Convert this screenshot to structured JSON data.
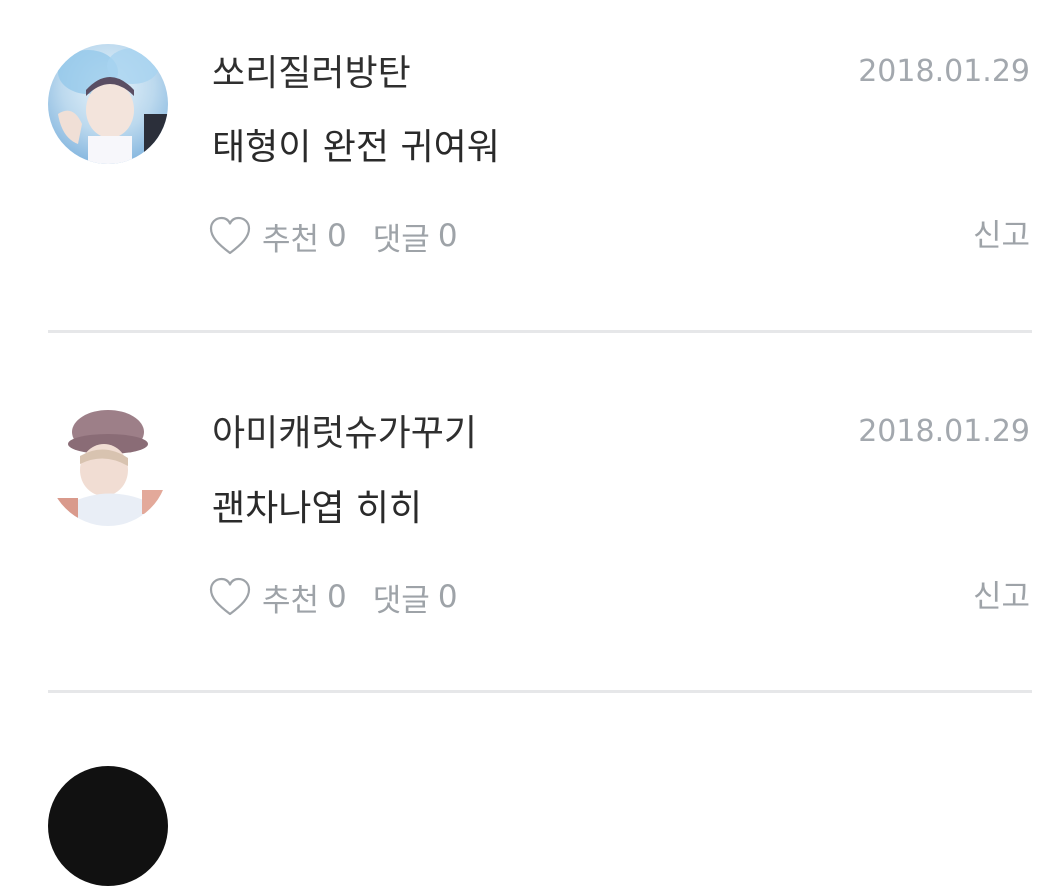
{
  "comments": [
    {
      "username": "쏘리질러방탄",
      "date": "2018.01.29",
      "text": "태형이 완전 귀여워",
      "like_label": "추천",
      "like_count": "0",
      "reply_label": "댓글",
      "reply_count": "0",
      "report_label": "신고"
    },
    {
      "username": "아미캐럿슈가꾸기",
      "date": "2018.01.29",
      "text": "괜차나엽 히히",
      "like_label": "추천",
      "like_count": "0",
      "reply_label": "댓글",
      "reply_count": "0",
      "report_label": "신고"
    }
  ],
  "icons": {
    "like": "heart-outline-icon"
  },
  "colors": {
    "meta_gray": "#9ea3a8",
    "divider": "#e6e7e9",
    "username": "#2f2f2f"
  }
}
